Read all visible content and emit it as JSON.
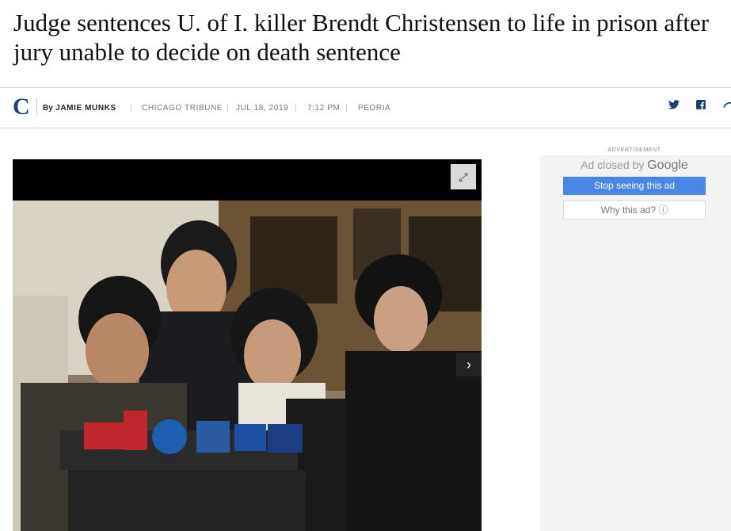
{
  "article": {
    "headline": "Judge sentences U. of I. killer Brendt Christensen to life in prison after jury unable to decide on death sentence"
  },
  "byline": {
    "logo_letter": "C",
    "by_prefix": "By",
    "author": "JAMIE MUNKS",
    "sep": "|",
    "outlet": "CHICAGO TRIBUNE",
    "date": "JUL 18, 2019",
    "time": "7:12 PM",
    "section": "PEORIA"
  },
  "social": {
    "twitter_icon": "twitter-icon",
    "facebook_icon": "facebook-icon",
    "share_icon": "share-icon"
  },
  "media": {
    "expand_icon": "expand-icon",
    "next_icon": "chevron-right-icon"
  },
  "ad": {
    "label": "ADVERTISEMENT",
    "closed_text": "Ad closed by",
    "brand": "Google",
    "stop_label": "Stop seeing this ad",
    "why_label": "Why this ad? ⓘ"
  },
  "colors": {
    "brand_navy": "#1e3e72",
    "ad_button_blue": "#4a86e8"
  }
}
